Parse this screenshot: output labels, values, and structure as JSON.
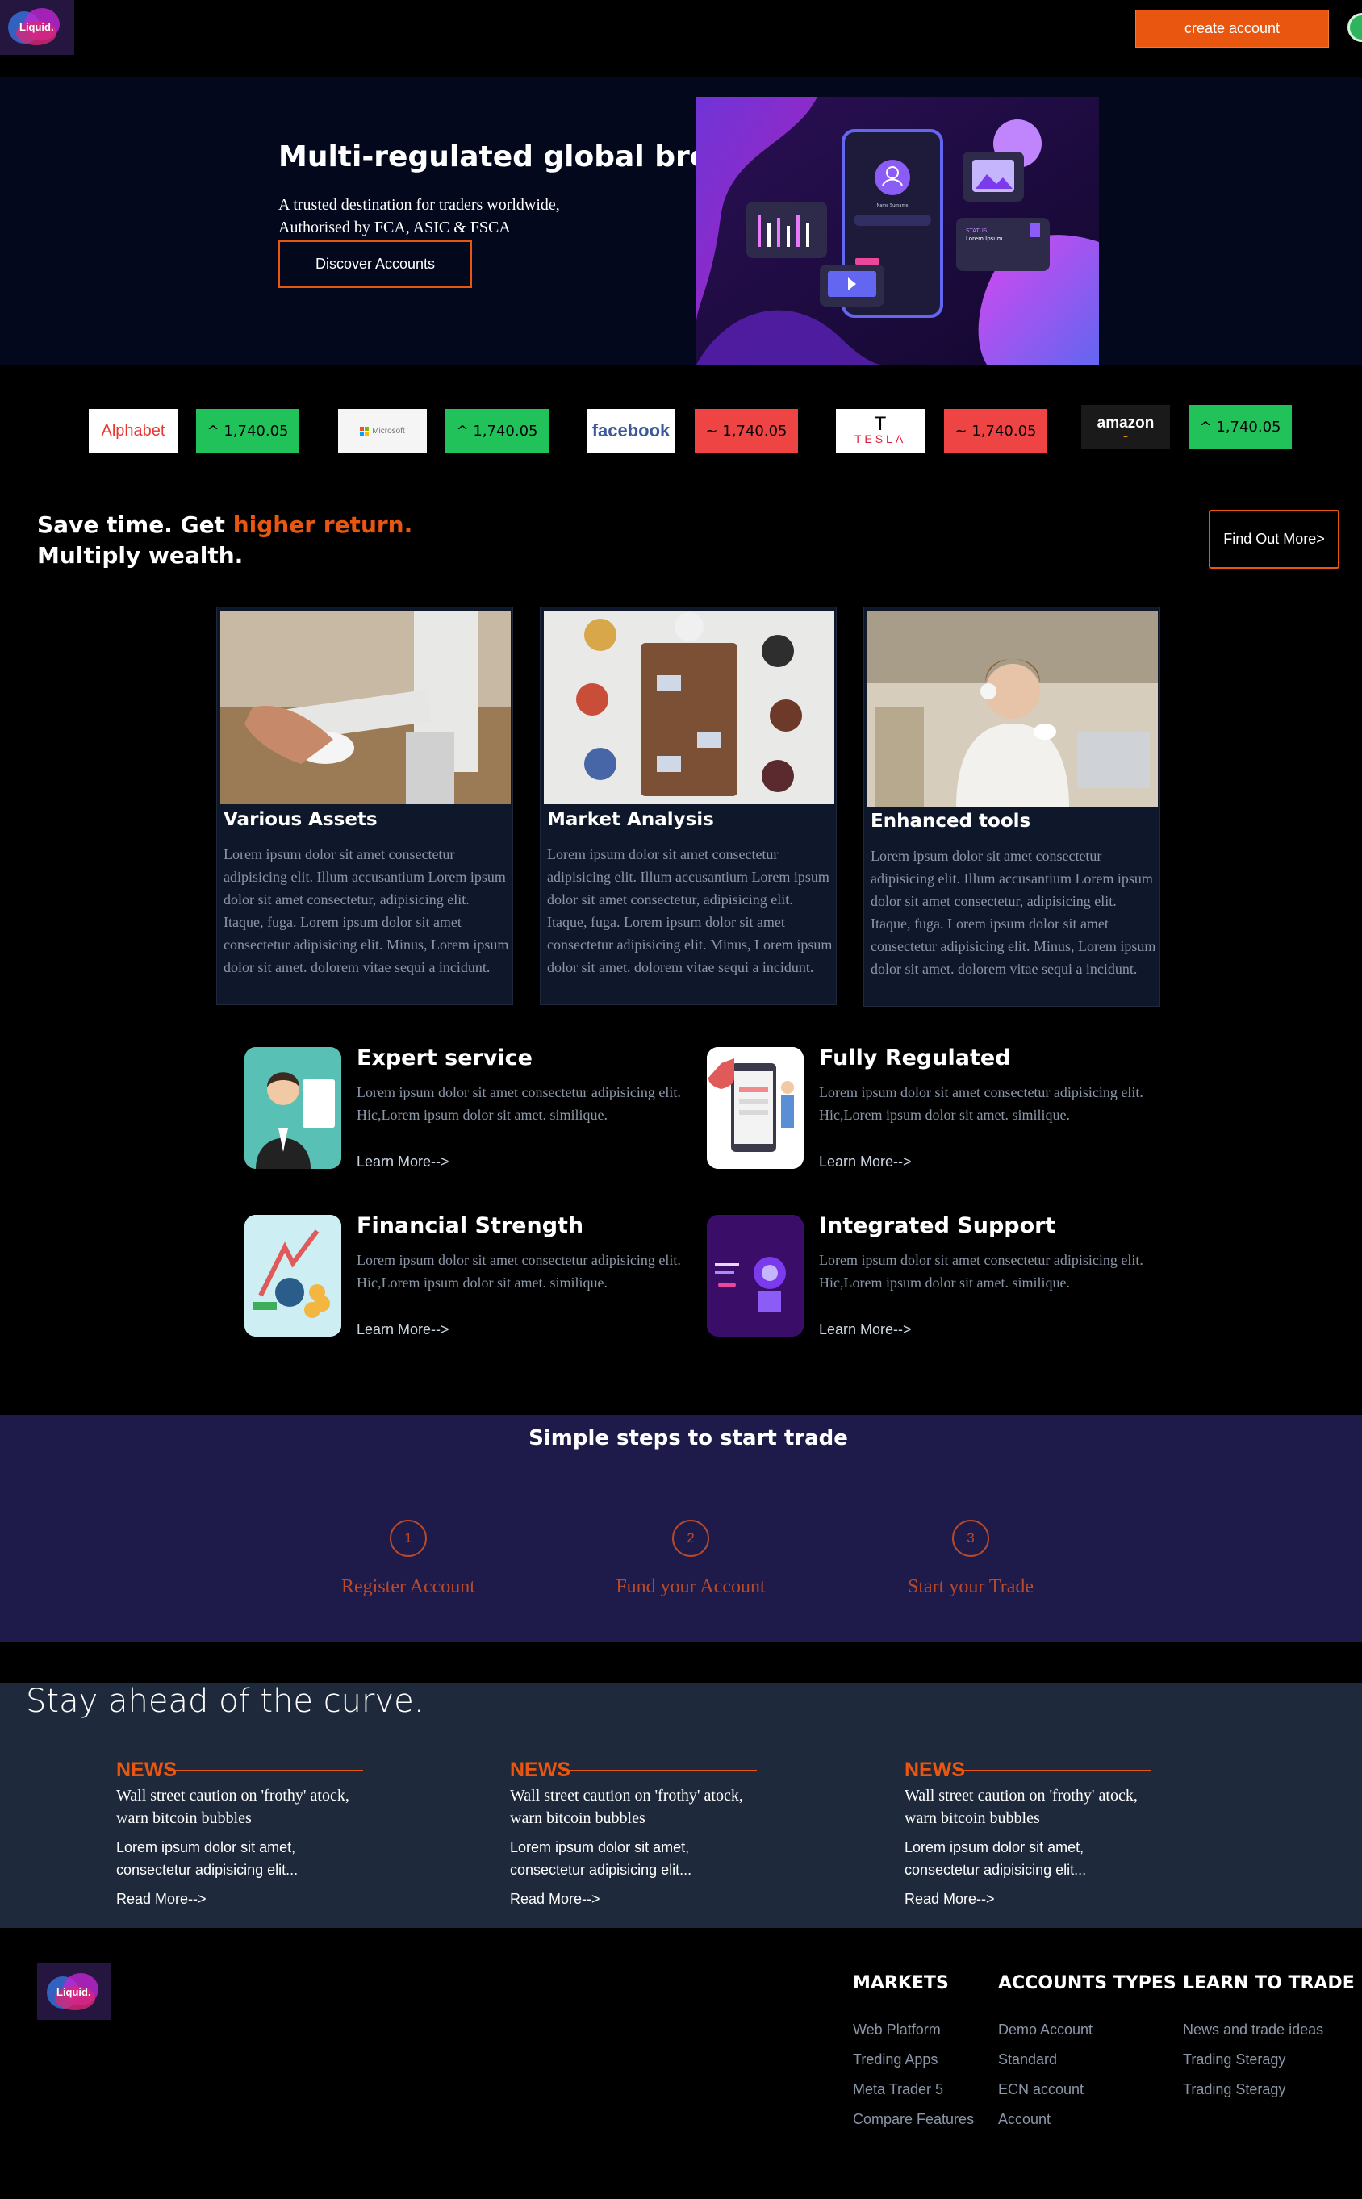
{
  "nav": {
    "logo_text": "Liquid.",
    "create_account": "create account"
  },
  "hero": {
    "title": "Multi-regulated global broker",
    "subtitle_line1": "A trusted destination for traders worldwide,",
    "subtitle_line2": "Authorised by FCA, ASIC & FSCA",
    "cta": "Discover Accounts",
    "mockup": {
      "profile_name": "Name Surname",
      "status_label": "STATUS",
      "status_text": "Lorem Ipsum"
    }
  },
  "tickers": [
    {
      "brand": "Alphabet",
      "value": "^ 1,740.05",
      "trend": "up"
    },
    {
      "brand": "Microsoft",
      "value": "^ 1,740.05",
      "trend": "up"
    },
    {
      "brand": "facebook",
      "value": "~ 1,740.05",
      "trend": "down"
    },
    {
      "brand": "TESLA",
      "value": "~ 1,740.05",
      "trend": "down"
    },
    {
      "brand": "amazon",
      "value": "^ 1,740.05",
      "trend": "up"
    }
  ],
  "promo": {
    "line1_a": "Save time. Get ",
    "line1_highlight": "higher return.",
    "line2": "Multiply wealth.",
    "cta": "Find Out More>"
  },
  "cards": [
    {
      "title": "Various Assets",
      "text": "Lorem ipsum dolor sit amet consectetur adipisicing elit. Illum accusantium Lorem ipsum dolor sit amet consectetur, adipisicing elit. Itaque, fuga. Lorem ipsum dolor sit amet consectetur adipisicing elit. Minus, Lorem ipsum dolor sit amet. dolorem vitae sequi a incidunt."
    },
    {
      "title": "Market Analysis",
      "text": "Lorem ipsum dolor sit amet consectetur adipisicing elit. Illum accusantium Lorem ipsum dolor sit amet consectetur, adipisicing elit. Itaque, fuga. Lorem ipsum dolor sit amet consectetur adipisicing elit. Minus, Lorem ipsum dolor sit amet. dolorem vitae sequi a incidunt."
    },
    {
      "title": "Enhanced tools",
      "text": "Lorem ipsum dolor sit amet consectetur adipisicing elit. Illum accusantium Lorem ipsum dolor sit amet consectetur, adipisicing elit. Itaque, fuga. Lorem ipsum dolor sit amet consectetur adipisicing elit. Minus, Lorem ipsum dolor sit amet. dolorem vitae sequi a incidunt."
    }
  ],
  "features": [
    {
      "title": "Expert service",
      "text": "Lorem ipsum dolor sit amet consectetur adipisicing elit. Hic,Lorem ipsum dolor sit amet. similique.",
      "link": "Learn More-->"
    },
    {
      "title": "Fully Regulated",
      "text": "Lorem ipsum dolor sit amet consectetur adipisicing elit. Hic,Lorem ipsum dolor sit amet. similique.",
      "link": "Learn More-->"
    },
    {
      "title": "Financial Strength",
      "text": "Lorem ipsum dolor sit amet consectetur adipisicing elit. Hic,Lorem ipsum dolor sit amet. similique.",
      "link": "Learn More-->"
    },
    {
      "title": "Integrated Support",
      "text": "Lorem ipsum dolor sit amet consectetur adipisicing elit. Hic,Lorem ipsum dolor sit amet. similique.",
      "link": "Learn More-->"
    }
  ],
  "steps": {
    "title": "Simple steps to start trade",
    "items": [
      {
        "num": "1",
        "label": "Register Account"
      },
      {
        "num": "2",
        "label": "Fund your Account"
      },
      {
        "num": "3",
        "label": "Start your Trade"
      }
    ]
  },
  "news": {
    "heading": "Stay ahead of the curve.",
    "items": [
      {
        "tag": "NEWS",
        "title": "Wall street caution on 'frothy' atock, warn bitcoin bubbles",
        "body": "Lorem ipsum dolor sit amet, consectetur adipisicing elit...",
        "link": "Read More-->"
      },
      {
        "tag": "NEWS",
        "title": "Wall street caution on 'frothy' atock, warn bitcoin bubbles",
        "body": "Lorem ipsum dolor sit amet, consectetur adipisicing elit...",
        "link": "Read More-->"
      },
      {
        "tag": "NEWS",
        "title": "Wall street caution on 'frothy' atock, warn bitcoin bubbles",
        "body": "Lorem ipsum dolor sit amet, consectetur adipisicing elit...",
        "link": "Read More-->"
      }
    ]
  },
  "footer": {
    "logo_text": "Liquid.",
    "columns": [
      {
        "heading": "MARKETS",
        "links": [
          "Web Platform",
          "Treding Apps",
          "Meta Trader 5",
          "Compare Features"
        ]
      },
      {
        "heading": "ACCOUNTS TYPES",
        "links": [
          "Demo Account",
          "Standard",
          "ECN account",
          "Account"
        ]
      },
      {
        "heading": "LEARN TO TRADE",
        "links": [
          "News and trade ideas",
          "Trading Steragy",
          "Trading Steragy"
        ]
      }
    ]
  },
  "colors": {
    "accent": "#e8560f",
    "up": "#21c25a",
    "down": "#ef4444",
    "steps_bg": "#1e1b4b",
    "news_bg": "#1e293b"
  }
}
